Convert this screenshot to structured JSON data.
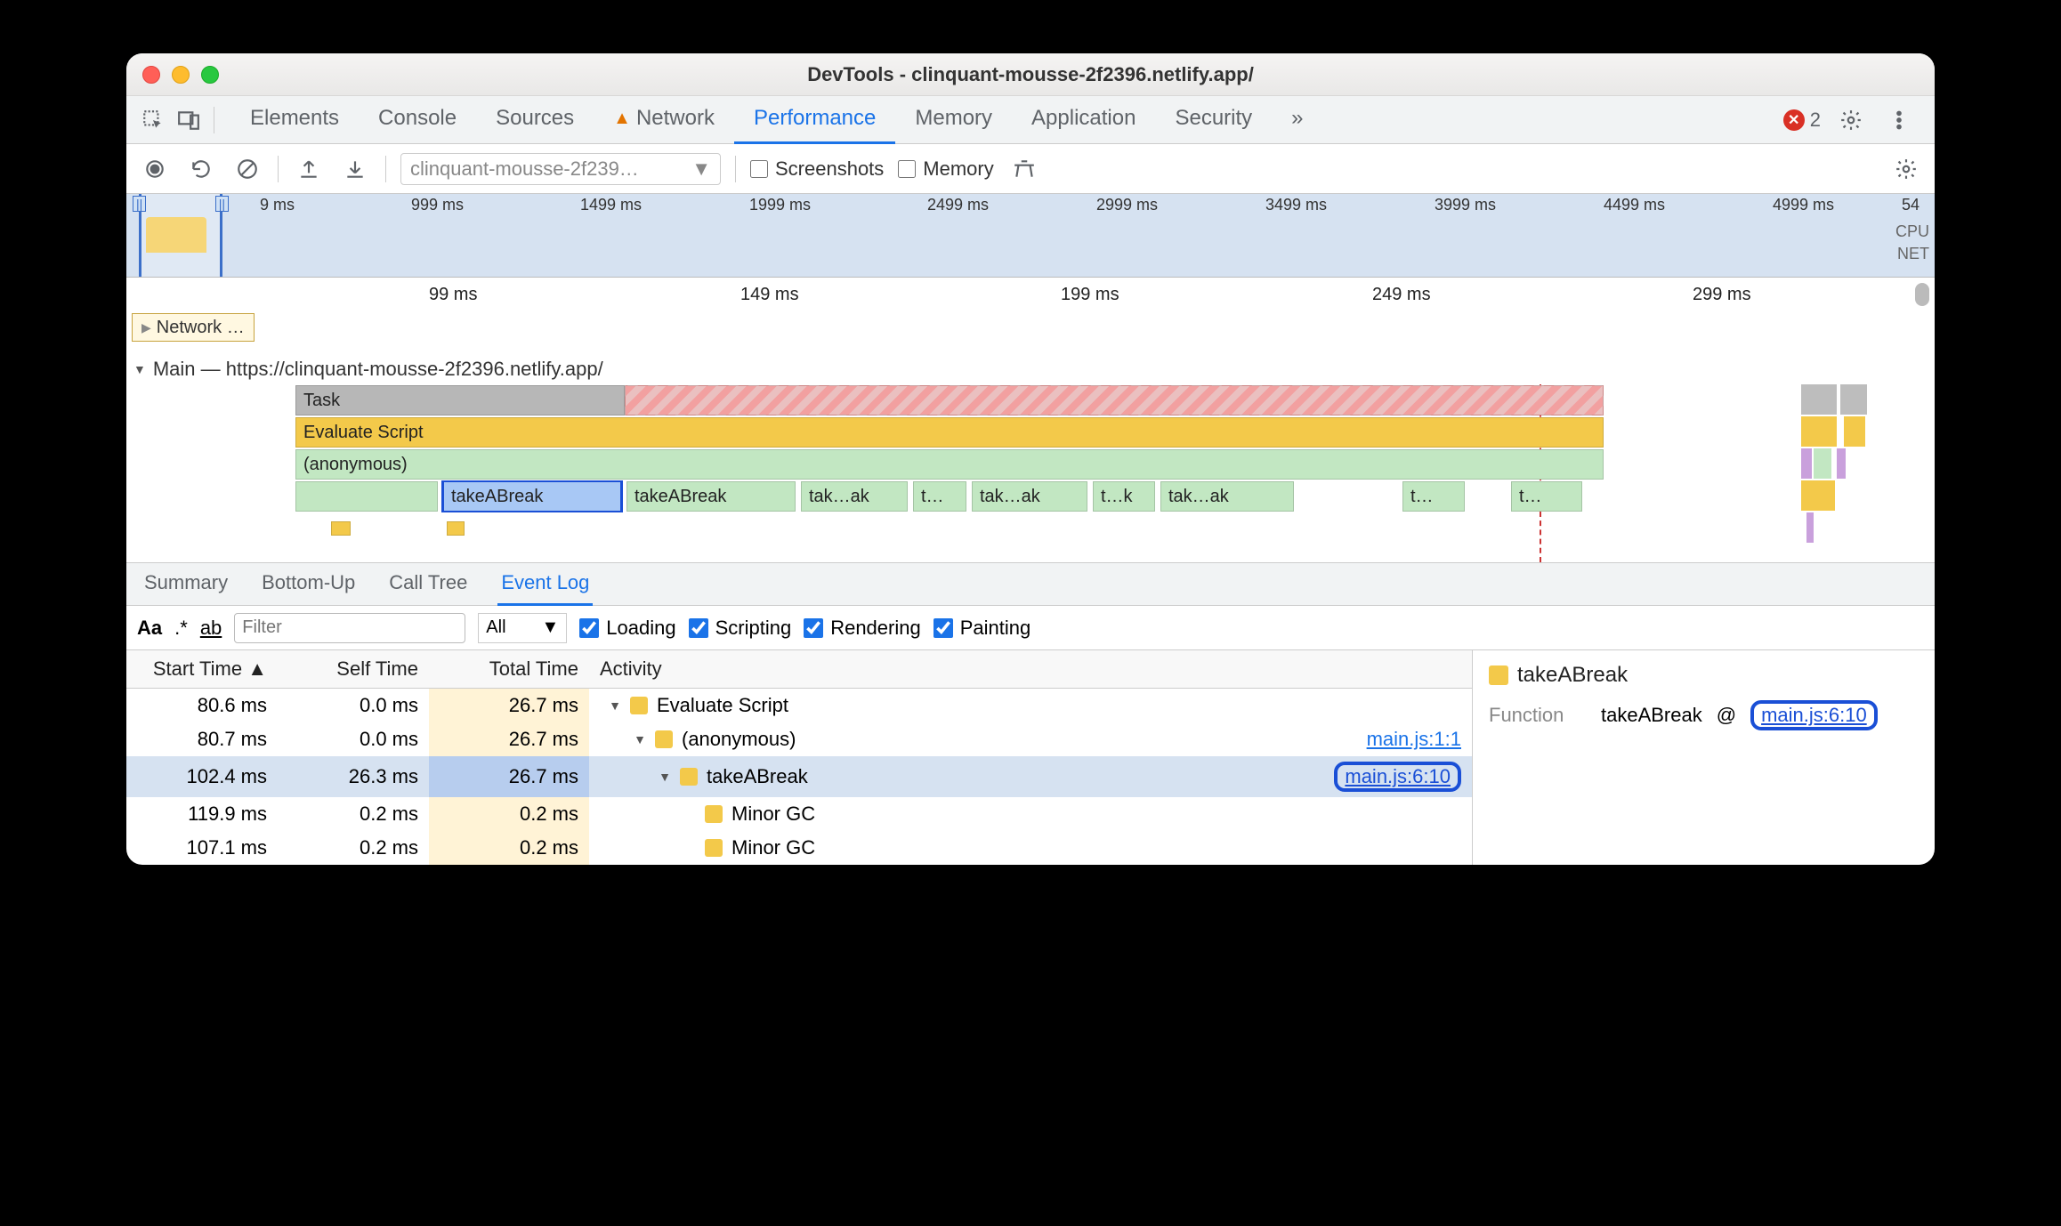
{
  "window": {
    "title": "DevTools - clinquant-mousse-2f2396.netlify.app/"
  },
  "tabs": {
    "items": [
      "Elements",
      "Console",
      "Sources",
      "Network",
      "Performance",
      "Memory",
      "Application",
      "Security"
    ],
    "active": "Performance",
    "warn_on": "Network",
    "more": "»",
    "errors": "2"
  },
  "toolbar": {
    "dropdown": "clinquant-mousse-2f239…",
    "screenshots": "Screenshots",
    "memory": "Memory"
  },
  "overview": {
    "ticks": [
      "9 ms",
      "999 ms",
      "1499 ms",
      "1999 ms",
      "2499 ms",
      "2999 ms",
      "3499 ms",
      "3999 ms",
      "4499 ms",
      "4999 ms",
      "54"
    ],
    "labels": {
      "cpu": "CPU",
      "net": "NET"
    }
  },
  "timeline": {
    "ticks": [
      "99 ms",
      "149 ms",
      "199 ms",
      "249 ms",
      "299 ms"
    ],
    "network_chip": "Network …",
    "main_label": "Main — https://clinquant-mousse-2f2396.netlify.app/",
    "rows": {
      "task": "Task",
      "eval": "Evaluate Script",
      "anon": "(anonymous)",
      "calls": [
        "takeABreak",
        "takeABreak",
        "tak…ak",
        "t…",
        "tak…ak",
        "t…k",
        "tak…ak",
        "t…",
        "t…"
      ]
    }
  },
  "panel_tabs": {
    "items": [
      "Summary",
      "Bottom-Up",
      "Call Tree",
      "Event Log"
    ],
    "active": "Event Log"
  },
  "filter": {
    "placeholder": "Filter",
    "all": "All",
    "loading": "Loading",
    "scripting": "Scripting",
    "rendering": "Rendering",
    "painting": "Painting",
    "aa": "Aa",
    "regex": ".*",
    "ab": "ab"
  },
  "table": {
    "headers": {
      "start": "Start Time",
      "self": "Self Time",
      "total": "Total Time",
      "activity": "Activity"
    },
    "sort_indicator": "▲",
    "rows": [
      {
        "start": "80.6 ms",
        "self": "0.0 ms",
        "total": "26.7 ms",
        "indent": 0,
        "tri": "▼",
        "label": "Evaluate Script",
        "loc": ""
      },
      {
        "start": "80.7 ms",
        "self": "0.0 ms",
        "total": "26.7 ms",
        "indent": 1,
        "tri": "▼",
        "label": "(anonymous)",
        "loc": "main.js:1:1"
      },
      {
        "start": "102.4 ms",
        "self": "26.3 ms",
        "total": "26.7 ms",
        "indent": 2,
        "tri": "▼",
        "label": "takeABreak",
        "loc": "main.js:6:10",
        "selected": true,
        "loc_hl": true
      },
      {
        "start": "119.9 ms",
        "self": "0.2 ms",
        "total": "0.2 ms",
        "indent": 3,
        "tri": "",
        "label": "Minor GC",
        "loc": ""
      },
      {
        "start": "107.1 ms",
        "self": "0.2 ms",
        "total": "0.2 ms",
        "indent": 3,
        "tri": "",
        "label": "Minor GC",
        "loc": ""
      }
    ]
  },
  "detail": {
    "title": "takeABreak",
    "func_label": "Function",
    "func_name": "takeABreak",
    "at": "@",
    "loc": "main.js:6:10"
  }
}
